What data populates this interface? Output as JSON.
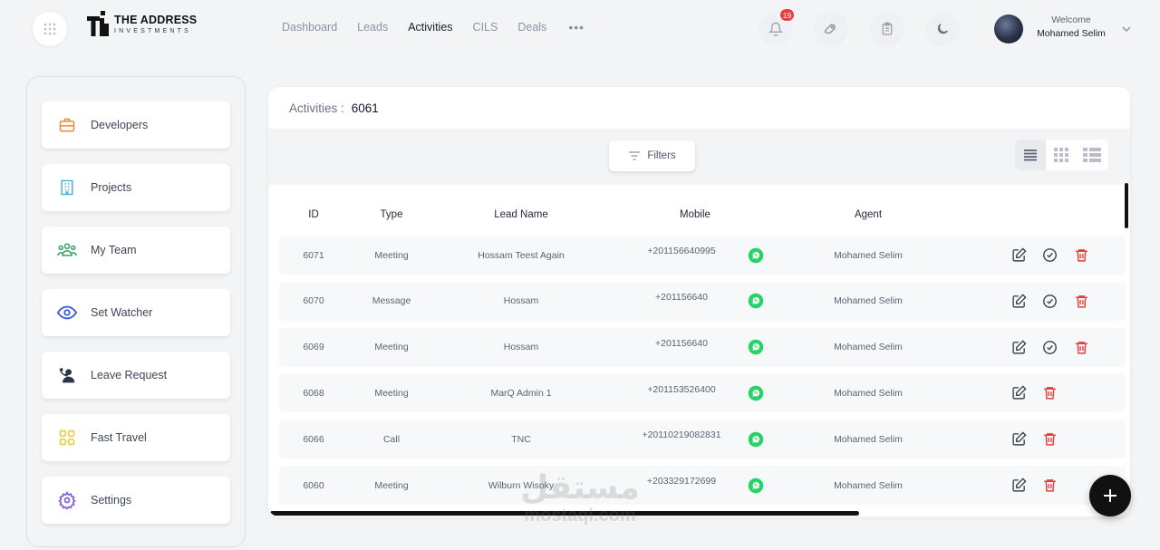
{
  "brand": {
    "line1": "THE ADDRESS",
    "line2": "INVESTMENTS"
  },
  "nav": {
    "items": [
      "Dashboard",
      "Leads",
      "Activities",
      "CILS",
      "Deals"
    ],
    "active": "Activities",
    "more": "•••"
  },
  "header": {
    "notifications_count": "19",
    "welcome": "Welcome",
    "user_name": "Mohamed Selim"
  },
  "sidebar": {
    "items": [
      {
        "label": "Developers",
        "icon": "briefcase-icon",
        "color": "#ed8936"
      },
      {
        "label": "Projects",
        "icon": "building-icon",
        "color": "#4fb3d9"
      },
      {
        "label": "My Team",
        "icon": "team-icon",
        "color": "#38a169"
      },
      {
        "label": "Set Watcher",
        "icon": "eye-icon",
        "color": "#3b5bdb"
      },
      {
        "label": "Leave Request",
        "icon": "person-phone-icon",
        "color": "#2d3748"
      },
      {
        "label": "Fast Travel",
        "icon": "grid-icon",
        "color": "#ecc94b"
      },
      {
        "label": "Settings",
        "icon": "gear-icon",
        "color": "#805ad5"
      }
    ]
  },
  "activities": {
    "title": "Activities :",
    "count": "6061",
    "filters_label": "Filters",
    "columns": {
      "id": "ID",
      "type": "Type",
      "lead": "Lead Name",
      "mobile": "Mobile",
      "agent": "Agent"
    },
    "rows": [
      {
        "id": "6071",
        "type": "Meeting",
        "lead": "Hossam Teest Again",
        "mobile": "+201156640995",
        "agent": "Mohamed Selim",
        "done": true
      },
      {
        "id": "6070",
        "type": "Message",
        "lead": "Hossam",
        "mobile": "+201156640",
        "agent": "Mohamed Selim",
        "done": true
      },
      {
        "id": "6069",
        "type": "Meeting",
        "lead": "Hossam",
        "mobile": "+201156640",
        "agent": "Mohamed Selim",
        "done": true
      },
      {
        "id": "6068",
        "type": "Meeting",
        "lead": "MarQ Admin 1",
        "mobile": "+201153526400",
        "agent": "Mohamed Selim",
        "done": false
      },
      {
        "id": "6066",
        "type": "Call",
        "lead": "TNC",
        "mobile": "+20110219082831",
        "agent": "Mohamed Selim",
        "done": false
      },
      {
        "id": "6060",
        "type": "Meeting",
        "lead": "Wilburn Wisoky",
        "mobile": "+203329172699",
        "agent": "Mohamed Selim",
        "done": false
      }
    ]
  },
  "watermark": {
    "line1": "مستقل",
    "line2": "mostaql.com"
  },
  "colors": {
    "danger": "#e53e3e",
    "whatsapp": "#25d366"
  }
}
